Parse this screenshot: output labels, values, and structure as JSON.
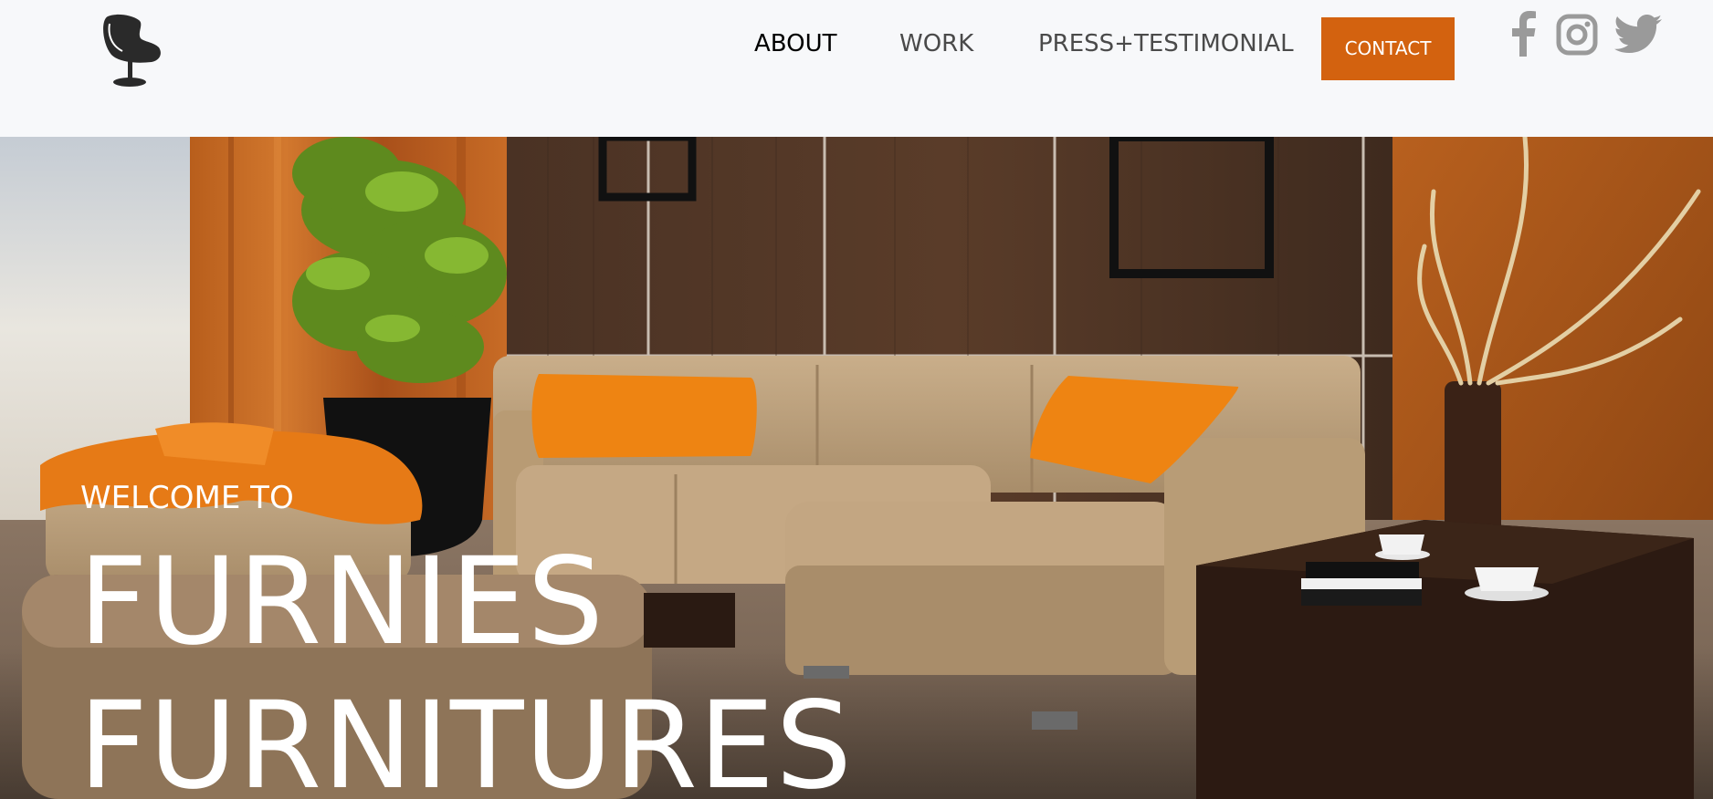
{
  "nav": {
    "items": [
      {
        "label": "ABOUT",
        "active": true
      },
      {
        "label": "WORK",
        "active": false
      },
      {
        "label": "PRESS+TESTIMONIAL",
        "active": false
      }
    ],
    "contact_label": "CONTACT"
  },
  "social": {
    "icons": [
      "facebook-icon",
      "instagram-icon",
      "twitter-icon"
    ]
  },
  "hero": {
    "welcome": "WELCOME TO",
    "title_line_1": "FURNIES",
    "title_line_2": "FURNITURES"
  },
  "colors": {
    "accent": "#d3620f",
    "header_bg": "#f7f8fa",
    "social_gray": "#9a9a9a"
  }
}
